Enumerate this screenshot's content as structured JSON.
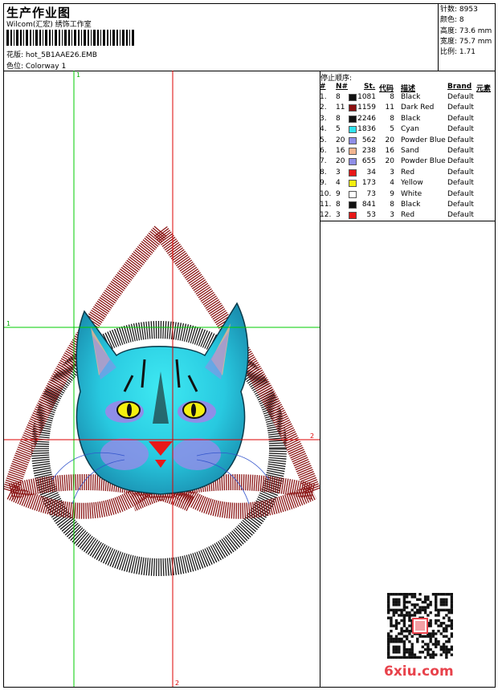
{
  "header": {
    "title": "生产作业图",
    "subtitle": "Wilcom(汇宏) 绣饰工作室",
    "file_label": "花版: hot_5B1AAE26.EMB",
    "color_label": "色位: Colorway 1"
  },
  "stats": [
    "针数: 8953",
    "颜色: 8",
    "高度: 73.6 mm",
    "宽度: 75.7 mm",
    "比例: 1.71"
  ],
  "sequence": {
    "title": "停止顺序:",
    "headers": {
      "num": "#",
      "needle": "N#",
      "stitches": "St.",
      "code": "代码",
      "desc": "描述",
      "brand": "Brand",
      "element": "元素"
    },
    "rows": [
      {
        "num": "1.",
        "needle": "8",
        "color": "#111111",
        "stitches": "1081",
        "code": "8",
        "desc": "Black",
        "brand": "Default"
      },
      {
        "num": "2.",
        "needle": "11",
        "color": "#8b1010",
        "stitches": "1159",
        "code": "11",
        "desc": "Dark Red",
        "brand": "Default"
      },
      {
        "num": "3.",
        "needle": "8",
        "color": "#111111",
        "stitches": "2246",
        "code": "8",
        "desc": "Black",
        "brand": "Default"
      },
      {
        "num": "4.",
        "needle": "5",
        "color": "#2fe3f0",
        "stitches": "1836",
        "code": "5",
        "desc": "Cyan",
        "brand": "Default"
      },
      {
        "num": "5.",
        "needle": "20",
        "color": "#8f8ee8",
        "stitches": "562",
        "code": "20",
        "desc": "Powder Blue",
        "brand": "Default"
      },
      {
        "num": "6.",
        "needle": "16",
        "color": "#f2b590",
        "stitches": "238",
        "code": "16",
        "desc": "Sand",
        "brand": "Default"
      },
      {
        "num": "7.",
        "needle": "20",
        "color": "#8f8ee8",
        "stitches": "655",
        "code": "20",
        "desc": "Powder Blue",
        "brand": "Default"
      },
      {
        "num": "8.",
        "needle": "3",
        "color": "#e81818",
        "stitches": "34",
        "code": "3",
        "desc": "Red",
        "brand": "Default"
      },
      {
        "num": "9.",
        "needle": "4",
        "color": "#f5f010",
        "stitches": "173",
        "code": "4",
        "desc": "Yellow",
        "brand": "Default"
      },
      {
        "num": "10.",
        "needle": "9",
        "color": "#ffffff",
        "stitches": "73",
        "code": "9",
        "desc": "White",
        "brand": "Default"
      },
      {
        "num": "11.",
        "needle": "8",
        "color": "#111111",
        "stitches": "841",
        "code": "8",
        "desc": "Black",
        "brand": "Default"
      },
      {
        "num": "12.",
        "needle": "3",
        "color": "#e81818",
        "stitches": "53",
        "code": "3",
        "desc": "Red",
        "brand": "Default"
      }
    ]
  },
  "axes": {
    "x1": "1",
    "x2": "2",
    "y1": "1",
    "y2": "2",
    "color_green": "#00cc00",
    "color_red": "#dd0000"
  },
  "logo": {
    "text": "6xiu.com",
    "color": "#e8424b"
  },
  "icons": {
    "qr": "qr-code-icon",
    "design": "cat-embroidery-design"
  }
}
